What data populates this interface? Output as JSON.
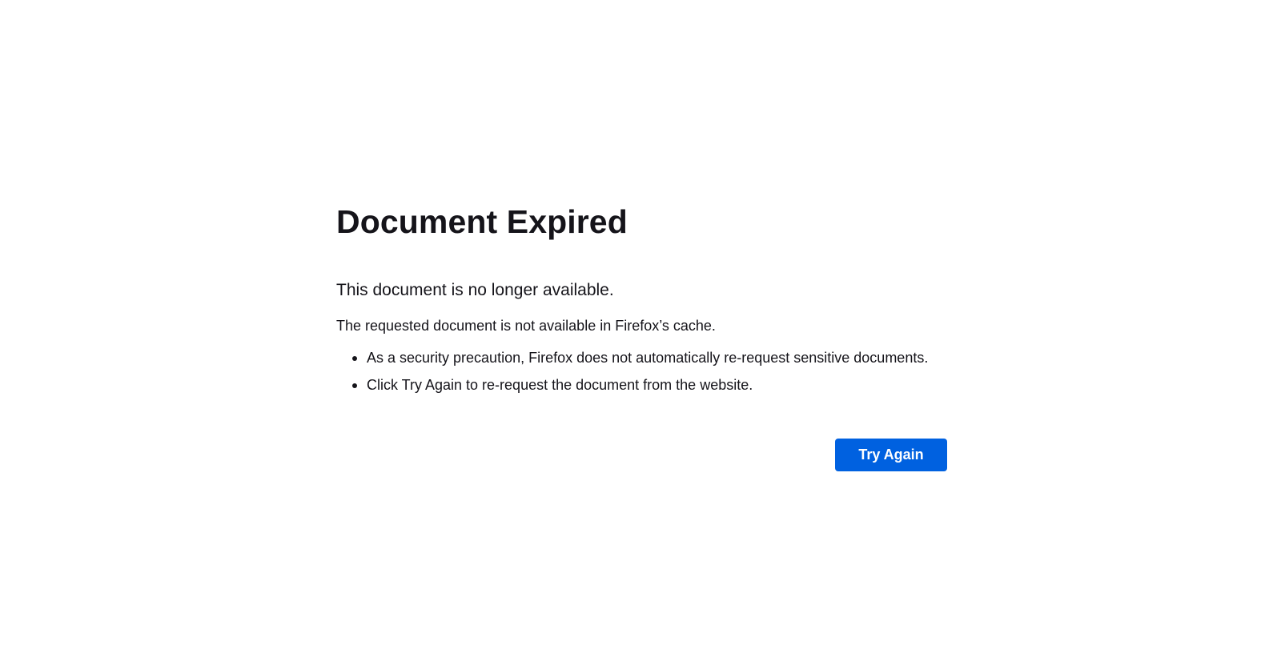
{
  "error": {
    "title": "Document Expired",
    "short_description": "This document is no longer available.",
    "long_description": "The requested document is not available in Firefox’s cache.",
    "reasons": [
      "As a security precaution, Firefox does not automatically re-request sensitive documents.",
      "Click Try Again to re-request the document from the website."
    ],
    "try_again_label": "Try Again"
  },
  "colors": {
    "background": "#ffffff",
    "text": "#15141a",
    "button": "#0061e0",
    "button_text": "#ffffff"
  }
}
